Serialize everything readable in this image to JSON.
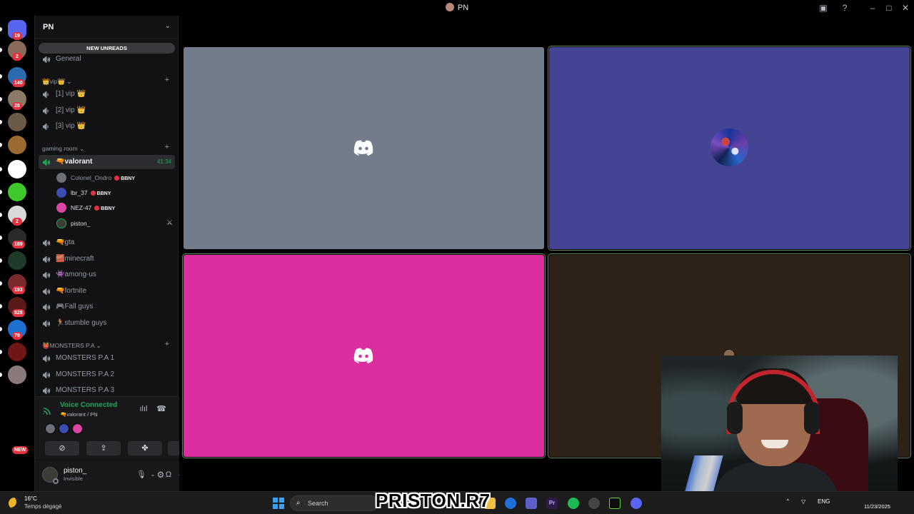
{
  "window": {
    "title": "PN"
  },
  "rail": {
    "servers": [
      {
        "name": "home",
        "badge": "19",
        "color": "#5865f2"
      },
      {
        "name": "dm-user",
        "badge": "2",
        "color": "#8a6a5a"
      },
      {
        "name": "server-a",
        "badge": "140",
        "color": "#2b6cb0"
      },
      {
        "name": "server-b",
        "badge": "28",
        "color": "#8a7a66"
      },
      {
        "name": "server-c",
        "badge": "",
        "color": "#6a5a48"
      },
      {
        "name": "server-d",
        "badge": "",
        "color": "#9a6a30"
      },
      {
        "name": "server-e",
        "badge": "",
        "color": "#ffffff"
      },
      {
        "name": "server-f",
        "badge": "",
        "color": "#3ec92b"
      },
      {
        "name": "server-g",
        "badge": "2",
        "color": "#d9d9d9"
      },
      {
        "name": "server-h",
        "badge": "189",
        "color": "#2a2a2a"
      },
      {
        "name": "server-i",
        "badge": "",
        "color": "#1e3b2a"
      },
      {
        "name": "server-j",
        "badge": "193",
        "color": "#7a2a2a"
      },
      {
        "name": "server-k",
        "badge": "828",
        "color": "#5a1a1a"
      },
      {
        "name": "server-l",
        "badge": "79",
        "color": "#1f6fd1"
      },
      {
        "name": "server-m",
        "badge": "",
        "color": "#701616"
      },
      {
        "name": "server-n",
        "badge": "",
        "color": "#8a7a7a"
      }
    ],
    "new_label": "NEW"
  },
  "sidebar": {
    "server_name": "PN",
    "new_unreads": "NEW UNREADS",
    "general": "General",
    "categories": {
      "vip": "👑vip👑",
      "gaming": "gaming room",
      "monsters": "👹MONSTERS P.A"
    },
    "vip_channels": [
      "[1] vip 👑",
      "[2] vip 👑",
      "[3] vip 👑"
    ],
    "active_channel": {
      "name": "🔫valorant",
      "time": "41:34"
    },
    "voice_users": [
      {
        "name": "Colonel_Ondro",
        "tag": "BBNY"
      },
      {
        "name": "lbr_37",
        "tag": "BBNY"
      },
      {
        "name": "NEZ-47",
        "tag": "BBNY"
      },
      {
        "name": "piston_",
        "tag": ""
      }
    ],
    "gaming_channels": [
      "🔫gta",
      "🧱minecraft",
      "👾among-us",
      "🔫fortnite",
      "🎮Fall guys",
      "🏃stumble guys"
    ],
    "monsters_channels": [
      "MONSTERS P.A 1",
      "MONSTERS P.A 2",
      "MONSTERS P.A 3"
    ]
  },
  "voice_panel": {
    "status": "Voice Connected",
    "location": "🔫valorant / PN"
  },
  "user": {
    "name": "piston_",
    "status": "Invisible"
  },
  "tiles": [
    {
      "name": "tile-1",
      "bg": "#737c8a",
      "kind": "logo"
    },
    {
      "name": "tile-2",
      "bg": "#444394",
      "kind": "avatar"
    },
    {
      "name": "tile-3",
      "bg": "#db2e9f",
      "kind": "logo"
    },
    {
      "name": "tile-4",
      "bg": "#2e2118",
      "kind": "camera"
    }
  ],
  "overlay": {
    "brand": "PRISTON.R7"
  },
  "taskbar": {
    "temperature": "16°C",
    "weather": "Temps dégagé",
    "search_placeholder": "Search",
    "language": "ENG",
    "date": "11/23/2025"
  }
}
